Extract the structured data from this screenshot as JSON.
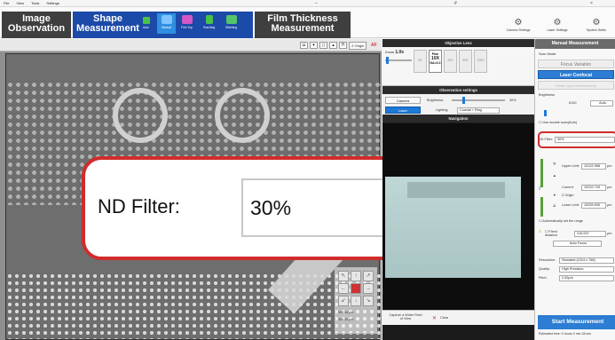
{
  "menu": {
    "file": "File",
    "view": "View",
    "tools": "Tools",
    "settings": "Settings"
  },
  "tabs": {
    "image": "Image\nObservation",
    "shape": "Shape\nMeasurement",
    "film": "Film Thickness\nMeasurement"
  },
  "shape_tools": [
    "Auto",
    "Manual",
    "Film Top",
    "Teaching",
    "Stitching"
  ],
  "right_tools": [
    "Camera Settings",
    "Laser Settings",
    "System Settin"
  ],
  "viewer": {
    "zorigin": "Z Origin",
    "af": "AF",
    "pos1": "999.56",
    "pos2": "300.50",
    "unit": "μm"
  },
  "callout": {
    "label": "ND Filter:",
    "value": "30%"
  },
  "objective": {
    "title": "Objective Lens",
    "zoom_label": "Zoom",
    "zoom_value": "1.0x",
    "lenses": [
      "5X",
      "10X",
      "20X",
      "50X",
      "100X"
    ],
    "selected_lens": "10X",
    "selected_top": "Plan",
    "selected_na": "NA=0.3"
  },
  "observation": {
    "title": "Observation settings",
    "camera": "Camera",
    "laser": "Laser",
    "brightness": "Brightness:",
    "brightness_val": "30%",
    "lighting": "Lighting:",
    "lighting_val": "Coaxial + Ring"
  },
  "navigation": {
    "title": "Navigation",
    "capture": "Capture a Wider Field of View",
    "clear": "Clear"
  },
  "manual": {
    "title": "Manual Measurement",
    "scan_mode": "Scan Mode:",
    "focus_variation": "Focus Variation",
    "laser_confocal": "Laser Confocal",
    "white_light": "White Light Interferometry",
    "brightness": "Brightness",
    "brightness_val": "6130",
    "auto": "Auto",
    "double_scan": "Use double scan(Auto)",
    "nd_filter": "ND Filter:",
    "nd_value": "30%",
    "upper_limit": "Upper Limit",
    "upper_val": "10122.968",
    "current": "Current:",
    "current_val": "10232.743",
    "z_origin": "Z Origin",
    "lower_limit": "Lower Limit",
    "lower_val": "10339.505",
    "auto_range": "Automatically set the range",
    "fixed_distance": "Fixed distance",
    "fixed_val": "216.537",
    "auto_focus": "Auto Focus",
    "resolution": "Resolution:",
    "resolution_val": "Standard (1024 x 768)",
    "quality": "Quality:",
    "quality_val": "High Precision",
    "pitch": "Pitch:",
    "pitch_val": "2.00μm",
    "unit": "μm",
    "start": "Start Measurement",
    "estimated": "Estimated time: 0 hours 0 min 28 sec"
  },
  "colors": {
    "tab_active": "#1c4aa8",
    "accent": "#2c7dd3",
    "highlight": "#d12c2c"
  }
}
